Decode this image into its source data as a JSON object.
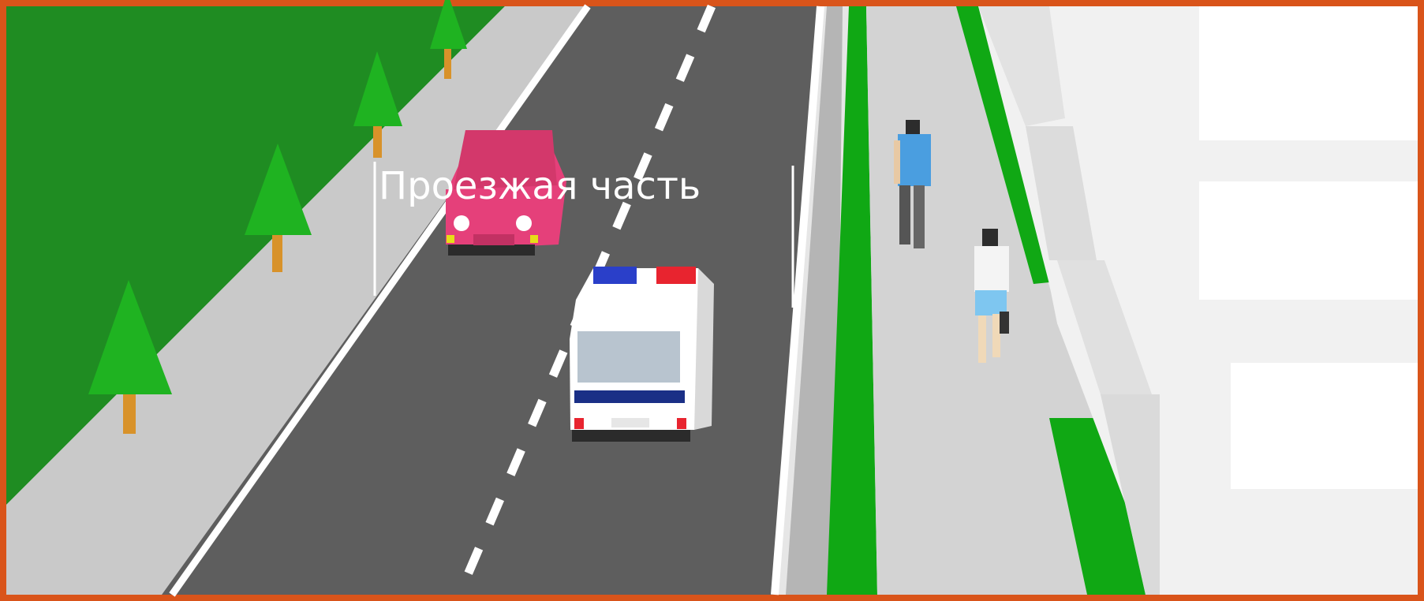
{
  "scene": {
    "road_label": "Проезжая часть"
  },
  "colors": {
    "frame_border": "#d9541a",
    "grass": "#1f8c22",
    "road": "#5e5e5e",
    "sidewalk": "#cfcfcf",
    "lane_marking": "#ffffff",
    "tree_foliage": "#1fb321",
    "tree_trunk": "#d8922a",
    "car": "#e5407a",
    "police_van": "#ffffff",
    "police_stripe": "#1a2f86",
    "siren_blue": "#2a3fc9",
    "siren_red": "#e8242f",
    "pedestrian_shirt_blue": "#4a9ee0",
    "pedestrian_shorts_blue": "#7ec6f0",
    "buildings": "#f2f2f2"
  },
  "icons": [
    "tree-icon",
    "car-icon",
    "police-van-icon",
    "pedestrian-icon",
    "building-icon"
  ]
}
